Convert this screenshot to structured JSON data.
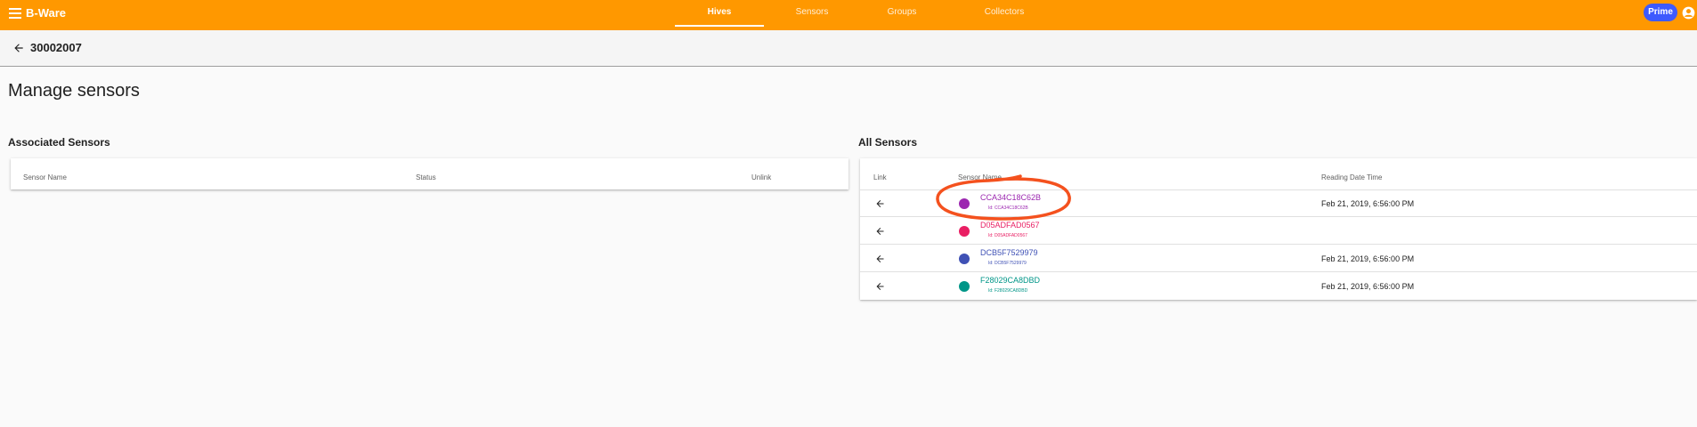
{
  "app": {
    "brand": "B-Ware",
    "nav_tabs": [
      {
        "label": "Hives",
        "active": true
      },
      {
        "label": "Sensors",
        "active": false
      },
      {
        "label": "Groups",
        "active": false
      },
      {
        "label": "Collectors",
        "active": false
      }
    ],
    "prime_label": "Prime",
    "accent_color": "#ff9800"
  },
  "subheader": {
    "title": "30002007"
  },
  "page": {
    "title": "Manage sensors"
  },
  "associated": {
    "title": "Associated Sensors",
    "columns": [
      "Sensor Name",
      "Status",
      "Unlink"
    ],
    "rows": []
  },
  "all_sensors": {
    "title": "All Sensors",
    "columns": [
      "Link",
      "Sensor Name",
      "Reading Date Time"
    ],
    "rows": [
      {
        "name": "CCA34C18C62B",
        "id": "Id: CCA34C18C62B",
        "reading": "Feb 21, 2019, 6:56:00 PM",
        "color": "#9c27b0"
      },
      {
        "name": "D05ADFAD0567",
        "id": "Id: D05ADFAD0567",
        "reading": "",
        "color": "#e91e63"
      },
      {
        "name": "DCB5F7529979",
        "id": "Id: DCB5F7529979",
        "reading": "Feb 21, 2019, 6:56:00 PM",
        "color": "#3f51b5"
      },
      {
        "name": "F28029CA8DBD",
        "id": "Id: F28029CA8DBD",
        "reading": "Feb 21, 2019, 6:56:00 PM",
        "color": "#009688"
      }
    ]
  },
  "annotation_color": "#f4511e"
}
